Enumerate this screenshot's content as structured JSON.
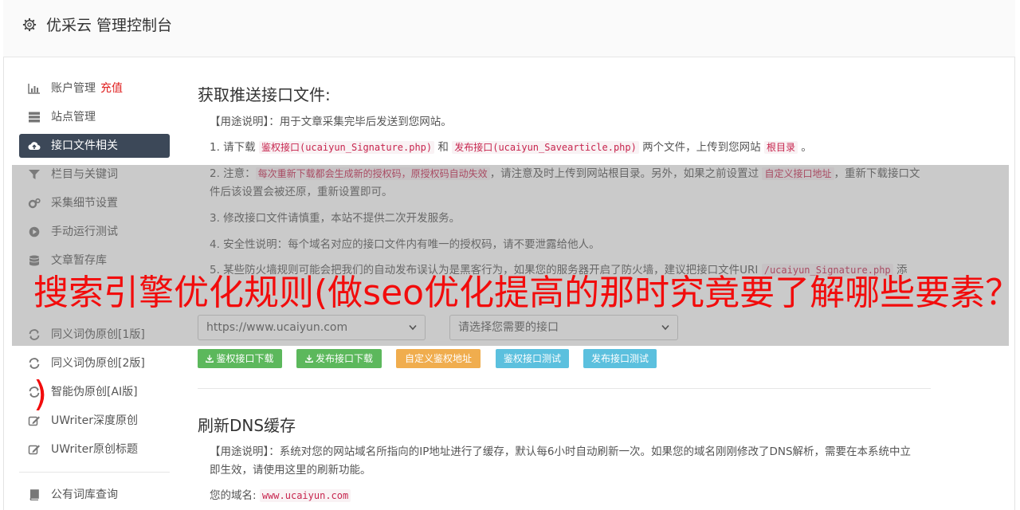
{
  "header": {
    "title": "优采云 管理控制台"
  },
  "sidebar": {
    "items": [
      {
        "label": "账户管理",
        "extra": "充值",
        "icon": "bar-chart-icon"
      },
      {
        "label": "站点管理",
        "icon": "server-icon"
      },
      {
        "label": "接口文件相关",
        "icon": "cloud-upload-icon",
        "active": true
      },
      {
        "label": "栏目与关键词",
        "icon": "filter-icon"
      },
      {
        "label": "采集细节设置",
        "icon": "cogs-icon"
      },
      {
        "label": "手动运行测试",
        "icon": "play-circle-icon"
      },
      {
        "label": "文章暂存库",
        "icon": "database-icon"
      },
      {
        "label": "同义词伪原创[1版]",
        "icon": "refresh-icon"
      },
      {
        "label": "同义词伪原创[2版]",
        "icon": "refresh-icon"
      },
      {
        "label": "智能伪原创[AI版]",
        "icon": "refresh-icon"
      },
      {
        "label": "UWriter深度原创",
        "icon": "edit-icon"
      },
      {
        "label": "UWriter原创标题",
        "icon": "edit-icon"
      },
      {
        "label": "公有词库查询",
        "icon": "book-icon"
      }
    ]
  },
  "section1": {
    "title": "获取推送接口文件:",
    "usage_tag": "【用途说明】",
    "usage_text": "：用于文章采集完毕后发送到您网站。",
    "p1_a": "1. 请下载 ",
    "p1_code1": "鉴权接口(ucaiyun_Signature.php)",
    "p1_b": " 和 ",
    "p1_code2": "发布接口(ucaiyun_Savearticle.php)",
    "p1_c": " 两个文件，上传到您网站 ",
    "p1_code3": "根目录",
    "p1_d": " 。",
    "p2_a": "2. 注意：",
    "p2_code1": "每次重新下载都会生成新的授权码，原授权码自动失效",
    "p2_b": "，请注意及时上传到网站根目录。另外，如果之前设置过 ",
    "p2_code2": "自定义接口地址",
    "p2_c": "，重新下载接口文件后该设置会被还原，重新设置即可。",
    "p3": "3. 修改接口文件请慎重，本站不提供二次开发服务。",
    "p4": "4. 安全性说明：每个域名对应的接口文件内有唯一的授权码，请不要泄露给他人。",
    "p5_a": "5. 某些防火墙规则可能会把我们的自动发布误认为是黑客行为，如果您的服务器开启了防火墙，建议把接口文件URI ",
    "p5_code": "/ucaiyun_Signature.php",
    "p5_b": " 添",
    "select_domain": "https://www.ucaiyun.com",
    "select_api": "请选择您需要的接口",
    "buttons": [
      {
        "label": "鉴权接口下载",
        "color": "#5cb85c"
      },
      {
        "label": "发布接口下载",
        "color": "#5cb85c"
      },
      {
        "label": "自定义鉴权地址",
        "color": "#f0ad4e"
      },
      {
        "label": "鉴权接口测试",
        "color": "#5bc0de"
      },
      {
        "label": "发布接口测试",
        "color": "#5bc0de"
      }
    ]
  },
  "section2": {
    "title": "刷新DNS缓存",
    "usage_tag": "【用途说明】",
    "usage_text": "：系统对您的网站域名所指向的IP地址进行了缓存，默认每6小时自动刷新一次。如果您的域名刚刚修改了DNS解析，需要在本系统中立即生效，请使用这里的刷新功能。",
    "domain_label": "您的域名:",
    "domain_value": "www.ucaiyun.com"
  },
  "overlay": {
    "headline": "搜索引擎优化规则(做seo优化提高的那时究竟要了解哪些要素？",
    "headline_tail": ")"
  },
  "colors": {
    "overlay_text": "#f20c0c",
    "active_bg": "#3c4858"
  }
}
